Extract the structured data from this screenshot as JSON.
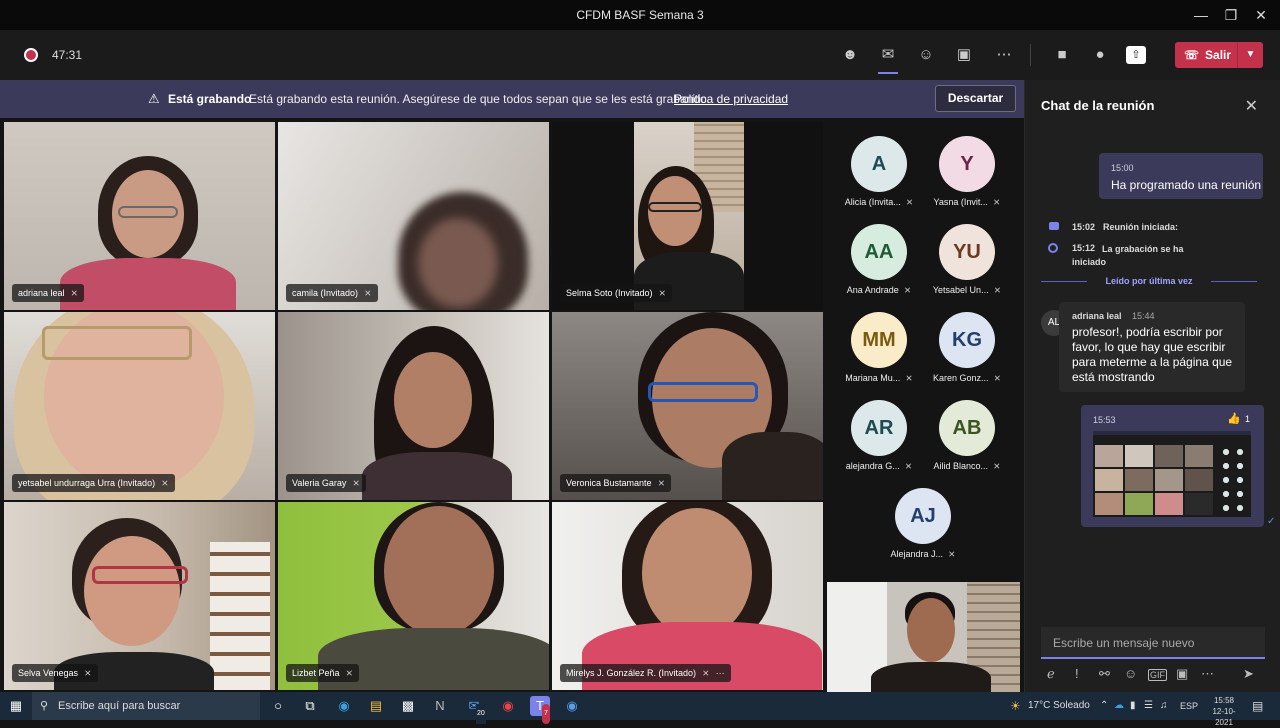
{
  "window": {
    "title": "CFDM BASF Semana 3"
  },
  "toolbar": {
    "timer": "47:31",
    "leave_label": "Salir"
  },
  "banner": {
    "title": "Está grabando",
    "message": "Está grabando esta reunión. Asegúrese de que todos sepan que se les está grabando.",
    "link": "Política de privacidad",
    "dismiss_label": "Descartar"
  },
  "video_tiles": [
    {
      "name": "adriana leal"
    },
    {
      "name": "camila (Invitado)"
    },
    {
      "name": "Selma Soto (Invitado)"
    },
    {
      "name": "yetsabel undurraga Urra (Invitado)"
    },
    {
      "name": "Valeria Garay"
    },
    {
      "name": "Veronica Bustamante"
    },
    {
      "name": "Selva Venegas"
    },
    {
      "name": "Lizbet Peña"
    },
    {
      "name": "Mirelys J. González R. (Invitado)"
    }
  ],
  "attendees": [
    {
      "initials": "A",
      "name": "Alicia (Invita...",
      "bg": "#dce8ea",
      "fg": "#1e4a52"
    },
    {
      "initials": "Y",
      "name": "Yasna (Invit...",
      "bg": "#f3dbe6",
      "fg": "#6b2348"
    },
    {
      "initials": "AA",
      "name": "Ana Andrade",
      "bg": "#d6ecdf",
      "fg": "#1e5a36"
    },
    {
      "initials": "YU",
      "name": "Yetsabel Un...",
      "bg": "#efe3dc",
      "fg": "#6b3a23"
    },
    {
      "initials": "MM",
      "name": "Mariana Mu...",
      "bg": "#faecc8",
      "fg": "#7a5a10"
    },
    {
      "initials": "KG",
      "name": "Karen Gonz...",
      "bg": "#dde5f3",
      "fg": "#23406b"
    },
    {
      "initials": "AR",
      "name": "alejandra G...",
      "bg": "#dce8ea",
      "fg": "#1e4a52"
    },
    {
      "initials": "AB",
      "name": "Ailid Blanco...",
      "bg": "#e3ead7",
      "fg": "#3d5220"
    },
    {
      "initials": "AJ",
      "name": "Alejandra J...",
      "bg": "#dde5f3",
      "fg": "#23406b"
    }
  ],
  "chat": {
    "title": "Chat de la reunión",
    "scheduled": {
      "time": "15:00",
      "text": "Ha programado una reunión"
    },
    "events": [
      {
        "time": "15:02",
        "text": "Reunión iniciada:"
      },
      {
        "time": "15:12",
        "text": "La grabación se ha iniciado"
      }
    ],
    "read_marker": "Leído por última vez",
    "message": {
      "author": "adriana leal",
      "avatar": "AL",
      "time": "15:44",
      "text": "profesor!, podría escribir por favor, lo que hay que escribir para meterme a la página que está mostrando"
    },
    "image_message": {
      "time": "15:53",
      "reaction_count": "1"
    },
    "compose_placeholder": "Escribe un mensaje nuevo"
  },
  "taskbar": {
    "search_placeholder": "Escribe aquí para buscar",
    "mail_badge": "20",
    "teams_badge": "7",
    "weather": "17°C  Soleado",
    "language": "ESP",
    "time": "15:58",
    "date": "12-10-2021"
  },
  "colors": {
    "accent": "#7b83eb",
    "leave": "#c4314b",
    "banner": "#3b3a5a"
  }
}
